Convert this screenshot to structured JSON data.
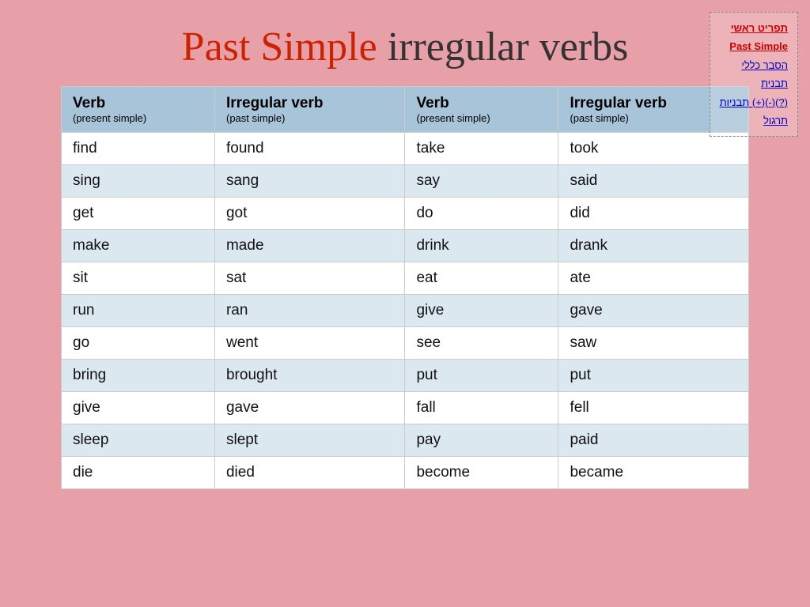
{
  "title": {
    "part1": "Past Simple",
    "part2": "irregular verbs"
  },
  "sidebar": {
    "items": [
      {
        "label": "תפריט ראשי",
        "active": true,
        "href": "#"
      },
      {
        "label": "Past Simple",
        "active": true,
        "href": "#"
      },
      {
        "label": "הסבר כללי",
        "active": false,
        "href": "#"
      },
      {
        "label": "תבנית",
        "active": false,
        "href": "#"
      },
      {
        "label": "תבניות (+)(-)(?)",
        "active": false,
        "href": "#"
      },
      {
        "label": "תרגול",
        "active": false,
        "href": "#"
      }
    ]
  },
  "table": {
    "headers": [
      {
        "main": "Verb",
        "sub": "(present simple)"
      },
      {
        "main": "Irregular verb",
        "sub": "(past simple)"
      },
      {
        "main": "Verb",
        "sub": "(present simple)"
      },
      {
        "main": "Irregular verb",
        "sub": "(past simple)"
      }
    ],
    "rows": [
      [
        "find",
        "found",
        "take",
        "took"
      ],
      [
        "sing",
        "sang",
        "say",
        "said"
      ],
      [
        "get",
        "got",
        "do",
        "did"
      ],
      [
        "make",
        "made",
        "drink",
        "drank"
      ],
      [
        "sit",
        "sat",
        "eat",
        "ate"
      ],
      [
        "run",
        "ran",
        "give",
        "gave"
      ],
      [
        "go",
        "went",
        "see",
        "saw"
      ],
      [
        "bring",
        "brought",
        "put",
        "put"
      ],
      [
        "give",
        "gave",
        "fall",
        "fell"
      ],
      [
        "sleep",
        "slept",
        "pay",
        "paid"
      ],
      [
        "die",
        "died",
        "become",
        "became"
      ]
    ]
  }
}
